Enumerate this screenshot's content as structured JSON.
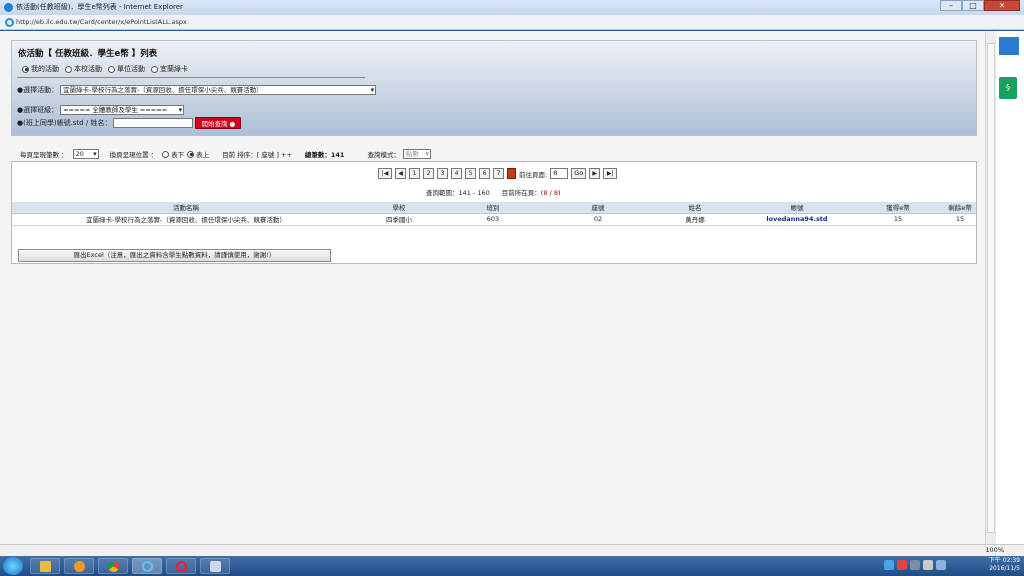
{
  "window": {
    "title": "依活動(任教班級)．學生e幣列表 - Internet Explorer",
    "url": "http://eb.ilc.edu.tw/Card/center/x/ePointListALL.aspx",
    "controls": [
      "–",
      "□",
      "✕"
    ]
  },
  "panel": {
    "title": "依活動【 任教班級．學生e幣 】列表",
    "radios": [
      {
        "label": "我的活動",
        "selected": true
      },
      {
        "label": "本校活動",
        "selected": false
      },
      {
        "label": "單位活動",
        "selected": false
      },
      {
        "label": "宜蘭綠卡",
        "selected": false
      }
    ],
    "activity_label": "●選擇活動：",
    "activity_value": "宜蘭綠卡-學校行為之落實-（資源回收、擔任環保小尖兵、競賽活動）",
    "class_label": "●選擇班級：",
    "class_value": "===== 全體教師及學生 =====",
    "search_label": "●(班上同學)帳號.std / 姓名：",
    "search_value": "",
    "search_button": "開始查詢"
  },
  "toolbar": {
    "per_page_label": "每頁呈現筆數 ：",
    "per_page_value": "20",
    "pager_pos_label": "換頁呈現位置 ：",
    "pos_options": [
      {
        "label": "表下",
        "selected": false
      },
      {
        "label": "表上",
        "selected": true
      }
    ],
    "sort_text": "目前 排序：[ 座號 ] ++",
    "total_text": "總筆數：141",
    "mode_label": "查詢模式：",
    "mode_value": "點數"
  },
  "pager": {
    "first": "|◀",
    "prev": "◀",
    "pages": [
      "1",
      "2",
      "3",
      "4",
      "5",
      "6",
      "7"
    ],
    "goto_label": "前往頁面:",
    "goto_value": "8",
    "go_button": "Go",
    "next": "▶",
    "last": "▶|"
  },
  "range": {
    "range_text": "查詢範圍：141 - 160",
    "current_prefix": "目前所在頁：(",
    "current_page": "8",
    "current_sep": " / ",
    "total_pages": "8",
    "current_suffix": ")"
  },
  "table": {
    "headers": [
      "活動名稱",
      "學校",
      "班別",
      "座號",
      "姓名",
      "帳號",
      "獲得e幣",
      "剩餘e幣"
    ],
    "rows": [
      [
        "宜蘭綠卡-學校行為之落實-（資源回收、擔任環保小尖兵、競賽活動）",
        "四季國小",
        "603",
        "02",
        "黃丹娜",
        "lovedanna94.std",
        "15",
        "15"
      ]
    ]
  },
  "export_button": "匯出Excel（注意，匯出之資料含學生點數資料，請謹慎使用，謝謝!）",
  "statusbar": {
    "zoom": "100%"
  },
  "taskbar": {
    "time": "下午 02:39",
    "date": "2016/11/5"
  },
  "colors": {
    "accent_red": "#d6001c",
    "panel_blue": "#aebfd6",
    "link_blue": "#1a2d8c"
  }
}
